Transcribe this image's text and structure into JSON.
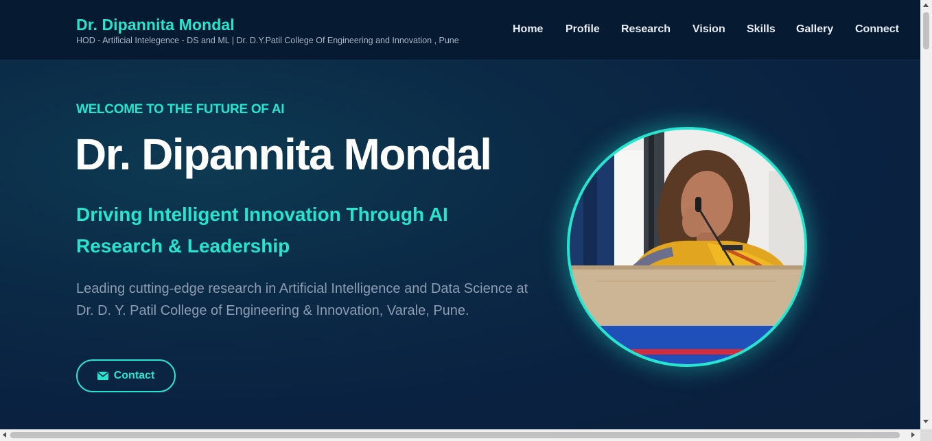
{
  "header": {
    "brand_name": "Dr. Dipannita Mondal",
    "brand_tagline": "HOD - Artificial Intelegence - DS and ML | Dr. D.Y.Patil College Of Engineering and Innovation , Pune",
    "nav": [
      {
        "label": "Home"
      },
      {
        "label": "Profile"
      },
      {
        "label": "Research"
      },
      {
        "label": "Vision"
      },
      {
        "label": "Skills"
      },
      {
        "label": "Gallery"
      },
      {
        "label": "Connect"
      }
    ]
  },
  "hero": {
    "eyebrow": "WELCOME TO THE FUTURE OF AI",
    "title": "Dr. Dipannita Mondal",
    "subtitle": "Driving Intelligent Innovation Through AI Research & Leadership",
    "description": "Leading cutting-edge research in Artificial Intelligence and Data Science at Dr. D. Y. Patil College of Engineering & Innovation, Varale, Pune.",
    "contact_button": {
      "label": "Contact",
      "icon": "envelope-icon"
    }
  },
  "portrait": {
    "icon": "profile-photo"
  },
  "colors": {
    "accent": "#22e6cf",
    "background": "#0a2241",
    "header_bg": "#061a31",
    "title": "#ffffff",
    "muted_text": "#8d9cb2"
  }
}
